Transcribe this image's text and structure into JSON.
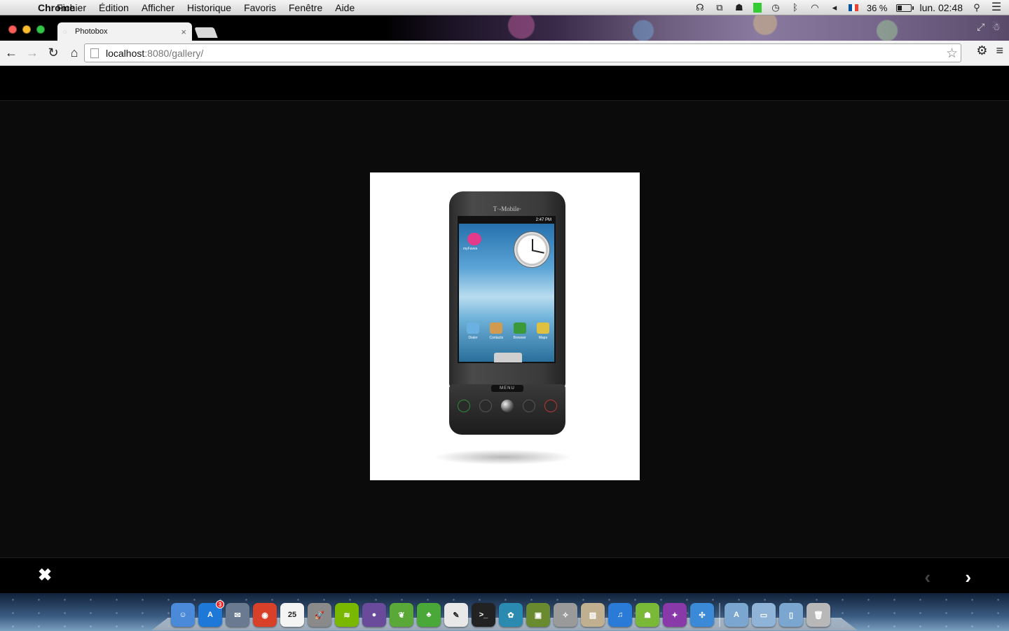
{
  "menubar": {
    "app_name": "Chrome",
    "menus": [
      "Fichier",
      "Édition",
      "Afficher",
      "Historique",
      "Favoris",
      "Fenêtre",
      "Aide"
    ],
    "battery_percent_text": "36 %",
    "battery_level": 0.36,
    "clock": "lun. 02:48",
    "icons": [
      "headphones-icon",
      "sync-icon",
      "bowler-hat-icon",
      "green-status-icon",
      "time-machine-icon",
      "bluetooth-icon",
      "wifi-icon",
      "volume-icon",
      "french-flag-icon",
      "battery-icon",
      "spotlight-icon",
      "notification-list-icon"
    ],
    "flag_colors": [
      "#0055a4",
      "#ffffff",
      "#ef4135"
    ]
  },
  "browser": {
    "tab_title": "Photobox",
    "url_host": "localhost",
    "url_rest": ":8080/gallery/",
    "glyphs": {
      "close": "×",
      "back": "←",
      "forward": "→",
      "reload": "↻",
      "home": "⌂",
      "star": "☆",
      "wrench": "⚙",
      "menu": "≡",
      "fullscreen": "⤢",
      "incognito": "☃"
    }
  },
  "gallery": {
    "close_glyph": "✖",
    "prev_glyph": "‹",
    "next_glyph": "›",
    "photo": {
      "brand": "T·-Mobile·",
      "status_time": "2:47 PM",
      "faves_label": "myFaves",
      "apps": [
        "Dialer",
        "Contacts",
        "Browser",
        "Maps"
      ],
      "menu_key": "MENU"
    }
  },
  "dock": {
    "items": [
      {
        "name": "finder",
        "color": "#4a8ad8",
        "glyph": "☺"
      },
      {
        "name": "app-store",
        "color": "#1e78d8",
        "glyph": "A",
        "badge": "3"
      },
      {
        "name": "mail-stamp",
        "color": "#6a7a90",
        "glyph": "✉"
      },
      {
        "name": "chrome",
        "color": "#d8402a",
        "glyph": "◉"
      },
      {
        "name": "calendar",
        "color": "#f4f4f4",
        "glyph": "25"
      },
      {
        "name": "launchpad",
        "color": "#8a8a8a",
        "glyph": "🚀"
      },
      {
        "name": "spotify",
        "color": "#7ab800",
        "glyph": "≋"
      },
      {
        "name": "eclipse",
        "color": "#6a4a9a",
        "glyph": "●"
      },
      {
        "name": "leaf",
        "color": "#5aa838",
        "glyph": "❦"
      },
      {
        "name": "adium",
        "color": "#4aa838",
        "glyph": "♣"
      },
      {
        "name": "evernote",
        "color": "#e8e8e8",
        "glyph": "✎"
      },
      {
        "name": "terminal",
        "color": "#222222",
        "glyph": ">_"
      },
      {
        "name": "network",
        "color": "#2a8ab0",
        "glyph": "✿"
      },
      {
        "name": "android-sdk",
        "color": "#6a8a30",
        "glyph": "▣"
      },
      {
        "name": "mayday",
        "color": "#9a9a9a",
        "glyph": "✧"
      },
      {
        "name": "photos",
        "color": "#c0b090",
        "glyph": "▨"
      },
      {
        "name": "itunes",
        "color": "#2a7ad8",
        "glyph": "♫"
      },
      {
        "name": "android",
        "color": "#7ab838",
        "glyph": "☗"
      },
      {
        "name": "vector-app",
        "color": "#8a3aa8",
        "glyph": "✦"
      },
      {
        "name": "safari",
        "color": "#3a8ad8",
        "glyph": "✣"
      }
    ],
    "folders": [
      {
        "name": "applications-folder",
        "color": "#7aa6d0",
        "glyph": "A"
      },
      {
        "name": "downloads-folder",
        "color": "#90b4d8",
        "glyph": "▭"
      },
      {
        "name": "documents-folder",
        "color": "#7aa6d0",
        "glyph": "▯"
      },
      {
        "name": "trash",
        "color": "#b8b8b8",
        "glyph": "🗑"
      }
    ]
  }
}
